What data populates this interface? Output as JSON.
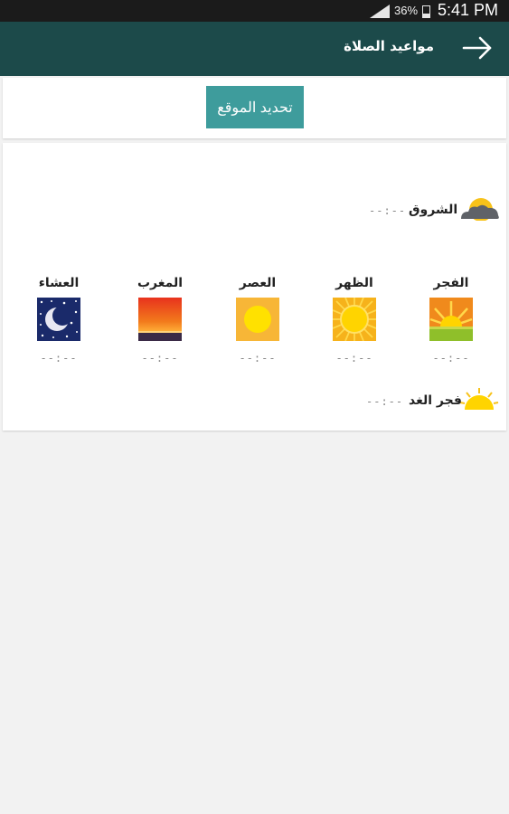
{
  "status_bar": {
    "battery_percent": "36%",
    "time": "5:41 PM"
  },
  "app_bar": {
    "title": "مواعيد الصلاة",
    "back_icon": "arrow-right-icon"
  },
  "actions": {
    "update_location_label": "تحديد الموقع"
  },
  "sunrise": {
    "label": "الشروق",
    "time": "--:--"
  },
  "prayers": [
    {
      "name": "الفجر",
      "time": "--:--",
      "icon": "sunrise-icon"
    },
    {
      "name": "الظهر",
      "time": "--:--",
      "icon": "noon-sun-icon"
    },
    {
      "name": "العصر",
      "time": "--:--",
      "icon": "afternoon-sun-icon"
    },
    {
      "name": "المغرب",
      "time": "--:--",
      "icon": "sunset-icon"
    },
    {
      "name": "العشاء",
      "time": "--:--",
      "icon": "moon-night-icon"
    }
  ],
  "next_fajr": {
    "label": "فجر الغد",
    "time": "--:--"
  },
  "colors": {
    "app_bar": "#1c4a4a",
    "button": "#3e9c9c",
    "background": "#f2f2f2"
  }
}
